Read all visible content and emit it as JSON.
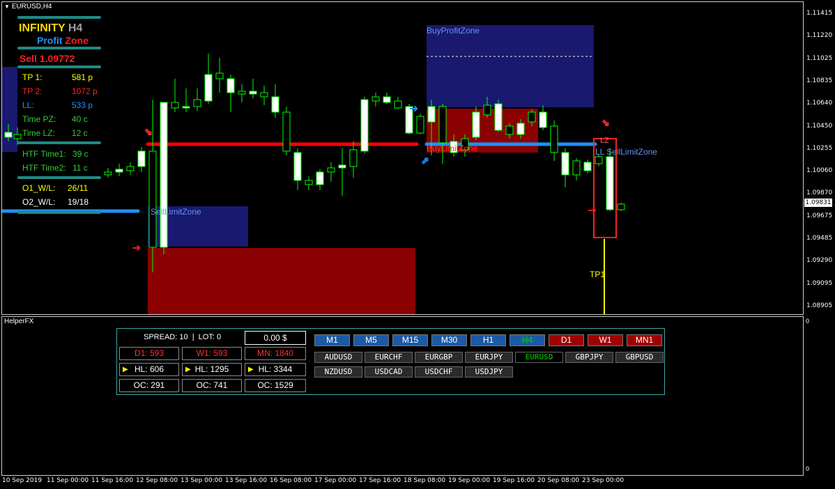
{
  "chart": {
    "title": "EURUSD,H4",
    "current_price": "1.09831",
    "price_ticks": [
      "1.11415",
      "1.11220",
      "1.11025",
      "1.10835",
      "1.10640",
      "1.10450",
      "1.10255",
      "1.10060",
      "1.09870",
      "1.09675",
      "1.09485",
      "1.09290",
      "1.09095",
      "1.08905"
    ],
    "time_ticks": [
      "10 Sep 2019",
      "11 Sep 00:00",
      "11 Sep 16:00",
      "12 Sep 08:00",
      "13 Sep 00:00",
      "13 Sep 16:00",
      "16 Sep 08:00",
      "17 Sep 00:00",
      "17 Sep 16:00",
      "18 Sep 08:00",
      "19 Sep 00:00",
      "19 Sep 16:00",
      "20 Sep 08:00",
      "23 Sep 00:00"
    ],
    "zones": {
      "buy_profit": "BuyProfitZone",
      "sell_limit_left": "SellLimitZone",
      "buy_limit": "BuyLimitZone",
      "ll_sell_limit": "LL SellLimitZone",
      "lz": "LZ",
      "tp1": "TP1"
    },
    "colors": {
      "bull": "#ffffff",
      "wick": "#00ff00",
      "zone_blue": "#191970",
      "zone_red": "#8b0000",
      "line_red": "#ff0000",
      "line_blue": "#1e90ff"
    }
  },
  "indicator": {
    "brand_infinity": "INFINITY",
    "brand_tf": "H4",
    "brand_profit": "Profit",
    "brand_zone": "Zone",
    "signal": "Sell 1.09772",
    "rows": [
      {
        "label": "TP 1:",
        "value": "581 p",
        "color": "#ffff00"
      },
      {
        "label": "TP 2:",
        "value": "1072 p",
        "color": "#ff2020"
      },
      {
        "label": "LL:",
        "value": "533 p",
        "color": "#1e90ff"
      },
      {
        "label": "Time PZ:",
        "value": "40 c",
        "color": "#32cd32"
      },
      {
        "label": "Time LZ:",
        "value": "12 c",
        "color": "#32cd32"
      },
      {
        "label": "HTF Time1:",
        "value": "39 c",
        "color": "#32cd32"
      },
      {
        "label": "HTF Time2:",
        "value": "11 c",
        "color": "#32cd32"
      },
      {
        "label": "O1_W/L:",
        "value": "26/11",
        "color": "#ffff00"
      },
      {
        "label": "O2_W/L:",
        "value": "19/18",
        "color": "#ffffff"
      }
    ]
  },
  "helper": {
    "title": "HelperFX",
    "scale_top": "0",
    "scale_bottom": "0",
    "spread_lot": "SPREAD: 10  |  LOT: 0",
    "profit": "0.00 $",
    "stats": {
      "d1": "D1: 593",
      "w1": "W1: 593",
      "mn": "MN: 1840",
      "hl1": "HL: 606",
      "hl2": "HL: 1295",
      "hl3": "HL: 3344",
      "oc1": "OC: 291",
      "oc2": "OC: 741",
      "oc3": "OC: 1529"
    },
    "timeframes": [
      "M1",
      "M5",
      "M15",
      "M30",
      "H1",
      "H4",
      "D1",
      "W1",
      "MN1"
    ],
    "symbols_row1": [
      "AUDUSD",
      "EURCHF",
      "EURGBP",
      "EURJPY",
      "EURUSD",
      "GBPJPY",
      "GBPUSD"
    ],
    "symbols_row2": [
      "NZDUSD",
      "USDCAD",
      "USDCHF",
      "USDJPY"
    ]
  }
}
